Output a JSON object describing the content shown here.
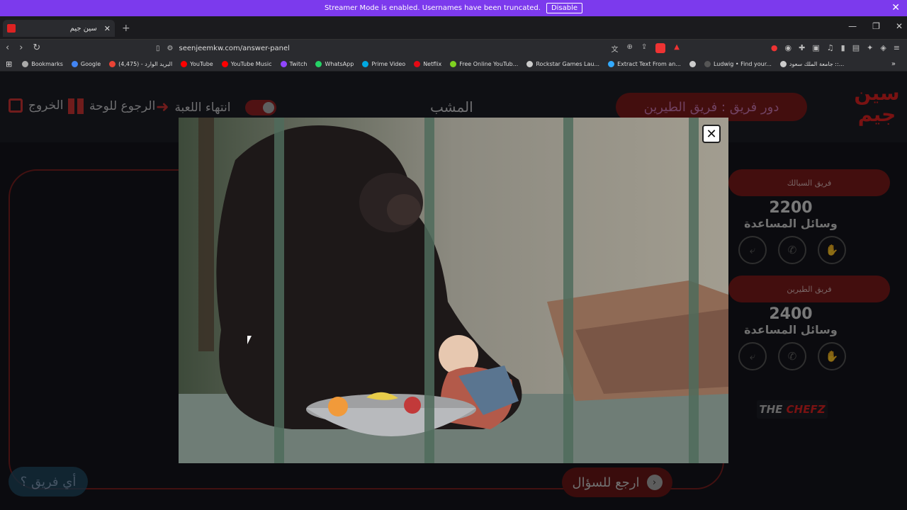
{
  "streamer": {
    "message": "Streamer Mode is enabled. Usernames have been truncated.",
    "disable_label": "Disable"
  },
  "tab": {
    "title": "سين جيم"
  },
  "url": "seenjeemkw.com/answer-panel",
  "bookmarks": [
    {
      "label": "Bookmarks",
      "color": "#aaaaaa"
    },
    {
      "label": "Google",
      "color": "#4285f4"
    },
    {
      "label": "البريد الوارد - (4,475)",
      "color": "#ea4335"
    },
    {
      "label": "YouTube",
      "color": "#ff0000"
    },
    {
      "label": "YouTube Music",
      "color": "#ff0000"
    },
    {
      "label": "Twitch",
      "color": "#9146ff"
    },
    {
      "label": "WhatsApp",
      "color": "#25d366"
    },
    {
      "label": "Prime Video",
      "color": "#00a8e1"
    },
    {
      "label": "Netflix",
      "color": "#e50914"
    },
    {
      "label": "Free Online YouTub...",
      "color": "#7fd120"
    },
    {
      "label": "Rockstar Games Lau...",
      "color": "#cccccc"
    },
    {
      "label": "Extract Text From an...",
      "color": "#33aaff"
    },
    {
      "label": "",
      "color": "#cccccc"
    },
    {
      "label": "Ludwig • Find your...",
      "color": "#222222"
    },
    {
      "label": "جامعة الملك سعود ::...",
      "color": "#cccccc"
    }
  ],
  "header": {
    "exit_label": "الخروج",
    "board_label": "الرجوع للوحة",
    "end_label": "انتهاء اللعبة",
    "category": "المشب",
    "turn_label": "دور فريق : فريق الطيرين",
    "logo": "سين جيم"
  },
  "teams": [
    {
      "name": "فريق السبالك",
      "score": "2200",
      "aids_label": "وسائل المساعدة"
    },
    {
      "name": "فريق الطيرين",
      "score": "2400",
      "aids_label": "وسائل المساعدة"
    }
  ],
  "sponsor": {
    "the": "THE",
    "chefz": "CHEFZ"
  },
  "which_team_label": "أي فريق ؟",
  "back_label": "ارجع للسؤال"
}
